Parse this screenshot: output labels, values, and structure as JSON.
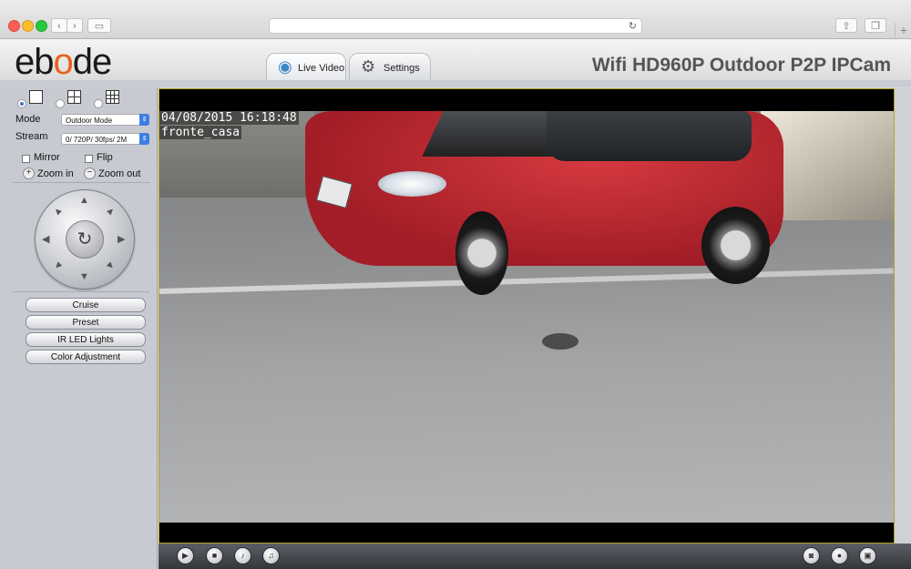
{
  "browser": {
    "back_icon": "chevron-left-icon",
    "forward_icon": "chevron-right-icon",
    "sidebar_icon": "sidebar-icon",
    "reload_icon": "reload-icon",
    "share_icon": "share-icon",
    "tabs_icon": "tabs-overview-icon",
    "new_tab_icon": "plus-icon"
  },
  "header": {
    "logo": "ebode",
    "product_title": "Wifi HD960P Outdoor P2P IPCam",
    "tabs": [
      {
        "label": "Live Video",
        "icon": "webcam-icon",
        "active": true
      },
      {
        "label": "Settings",
        "icon": "gears-icon",
        "active": false
      }
    ]
  },
  "panel": {
    "layouts": [
      {
        "icon": "single-view-icon",
        "selected": true
      },
      {
        "icon": "quad-view-icon",
        "selected": false
      },
      {
        "icon": "nine-view-icon",
        "selected": false
      }
    ],
    "mode_label": "Mode",
    "mode_value": "Outdoor Mode",
    "stream_label": "Stream",
    "stream_value": "0/ 720P/ 30fps/ 2M",
    "mirror_label": "Mirror",
    "flip_label": "Flip",
    "zoom_in_label": "Zoom in",
    "zoom_out_label": "Zoom out",
    "buttons": [
      "Cruise",
      "Preset",
      "IR LED Lights",
      "Color Adjustment"
    ]
  },
  "video": {
    "timestamp": "04/08/2015 16:18:48",
    "camera_name": "fronte_casa"
  },
  "toolbar": {
    "left_icons": [
      "play-icon",
      "stop-icon",
      "talk-icon",
      "audio-icon"
    ],
    "right_icons": [
      "snapshot-icon",
      "record-icon",
      "fullscreen-icon"
    ]
  },
  "colors": {
    "logo_accent": "#e8631a",
    "select_arrow": "#3b7ee6",
    "video_border": "#b3a12a"
  }
}
